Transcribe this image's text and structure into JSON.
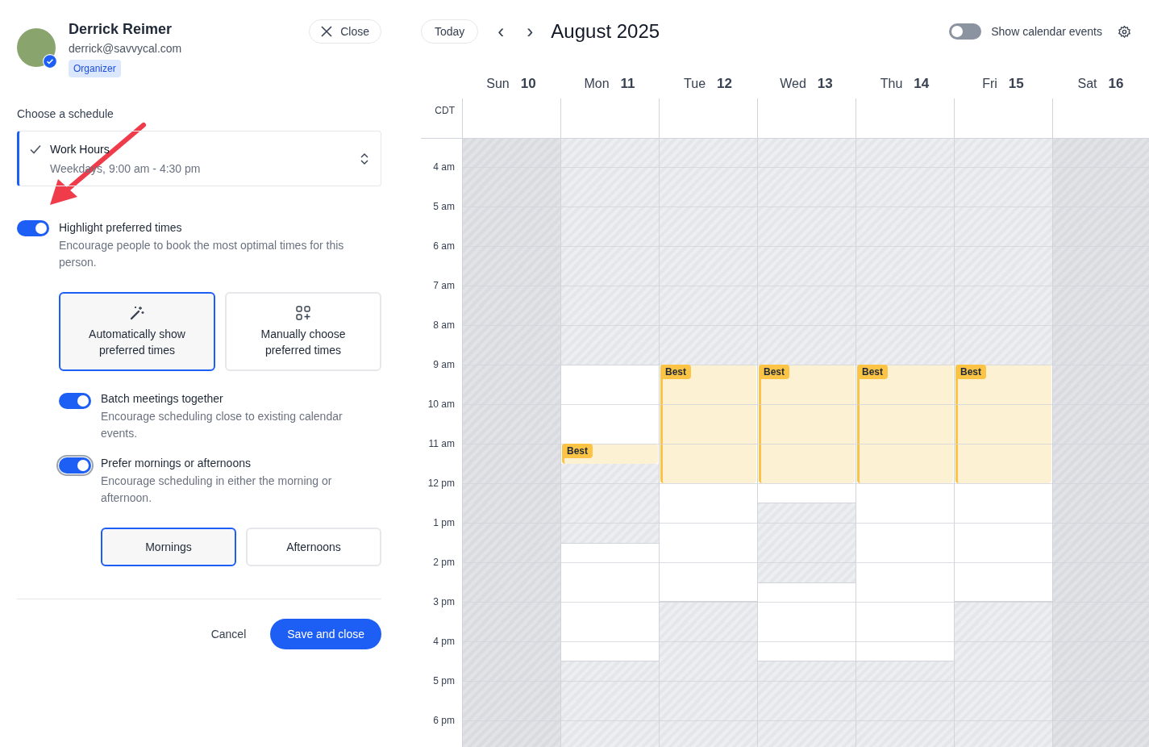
{
  "person": {
    "name": "Derrick Reimer",
    "email": "derrick@savvycal.com",
    "role": "Organizer",
    "verified": true
  },
  "close_button": {
    "label": "Close"
  },
  "schedule": {
    "label": "Choose a schedule",
    "name": "Work Hours",
    "detail": "Weekdays, 9:00 am - 4:30 pm",
    "checked": true
  },
  "highlight": {
    "label": "Highlight preferred times",
    "description": "Encourage people to book the most optimal times for this person.",
    "on": true
  },
  "modes": [
    {
      "label": "Automatically show preferred times",
      "kind": "auto",
      "selected": true
    },
    {
      "label": "Manually choose preferred times",
      "kind": "manual",
      "selected": false
    }
  ],
  "options": [
    {
      "label": "Batch meetings together",
      "description": "Encourage scheduling close to existing calendar events.",
      "on": true,
      "focused": false
    },
    {
      "label": "Prefer mornings or afternoons",
      "description": "Encourage scheduling in either the morning or afternoon.",
      "on": true,
      "focused": true
    }
  ],
  "day_parts": [
    {
      "label": "Mornings",
      "selected": true
    },
    {
      "label": "Afternoons",
      "selected": false
    }
  ],
  "footer": {
    "cancel": "Cancel",
    "save": "Save and close"
  },
  "toolbar": {
    "today": "Today",
    "prev": "‹",
    "next": "›",
    "title": "August 2025",
    "toggle_label": "Show calendar events",
    "toggle_on": false
  },
  "timezone": "CDT",
  "hours": [
    "4 am",
    "5 am",
    "6 am",
    "7 am",
    "8 am",
    "9 am",
    "10 am",
    "11 am",
    "12 pm",
    "1 pm",
    "2 pm",
    "3 pm",
    "4 pm",
    "5 pm",
    "6 pm"
  ],
  "days": [
    {
      "name": "Sun",
      "date": "10",
      "slots": [
        {
          "kind": "off"
        },
        {
          "kind": "off"
        },
        {
          "kind": "off"
        },
        {
          "kind": "off"
        },
        {
          "kind": "off"
        },
        {
          "kind": "off"
        },
        {
          "kind": "off"
        },
        {
          "kind": "off"
        },
        {
          "kind": "off"
        },
        {
          "kind": "off"
        },
        {
          "kind": "off"
        },
        {
          "kind": "off"
        },
        {
          "kind": "off"
        },
        {
          "kind": "off"
        },
        {
          "kind": "off"
        },
        {
          "kind": "off"
        },
        {
          "kind": "off"
        },
        {
          "kind": "off"
        },
        {
          "kind": "off"
        },
        {
          "kind": "off"
        },
        {
          "kind": "off"
        },
        {
          "kind": "off"
        },
        {
          "kind": "off"
        },
        {
          "kind": "off"
        },
        {
          "kind": "off"
        },
        {
          "kind": "off"
        },
        {
          "kind": "off"
        },
        {
          "kind": "off"
        },
        {
          "kind": "off"
        },
        {
          "kind": "off"
        },
        {
          "kind": "off"
        },
        {
          "kind": "off"
        }
      ]
    },
    {
      "name": "Mon",
      "date": "11",
      "best_label": "Best",
      "slots": [
        {
          "kind": "unavailable"
        },
        {
          "kind": "unavailable"
        },
        {
          "kind": "unavailable"
        },
        {
          "kind": "unavailable"
        },
        {
          "kind": "unavailable"
        },
        {
          "kind": "unavailable"
        },
        {
          "kind": "unavailable"
        },
        {
          "kind": "unavailable"
        },
        {
          "kind": "unavailable"
        },
        {
          "kind": "unavailable"
        },
        {
          "kind": "unavailable"
        },
        {
          "kind": "unavailable"
        },
        {
          "kind": "available"
        },
        {
          "kind": "available"
        },
        {
          "kind": "available"
        },
        {
          "kind": "available"
        },
        {
          "kind": "best"
        },
        {
          "kind": "unavailable"
        },
        {
          "kind": "unavailable"
        },
        {
          "kind": "unavailable"
        },
        {
          "kind": "unavailable"
        },
        {
          "kind": "available"
        },
        {
          "kind": "available"
        },
        {
          "kind": "available"
        },
        {
          "kind": "available"
        },
        {
          "kind": "available"
        },
        {
          "kind": "available"
        },
        {
          "kind": "unavailable"
        },
        {
          "kind": "unavailable"
        },
        {
          "kind": "unavailable"
        },
        {
          "kind": "unavailable"
        },
        {
          "kind": "unavailable"
        }
      ]
    },
    {
      "name": "Tue",
      "date": "12",
      "best_label": "Best",
      "slots": [
        {
          "kind": "unavailable"
        },
        {
          "kind": "unavailable"
        },
        {
          "kind": "unavailable"
        },
        {
          "kind": "unavailable"
        },
        {
          "kind": "unavailable"
        },
        {
          "kind": "unavailable"
        },
        {
          "kind": "unavailable"
        },
        {
          "kind": "unavailable"
        },
        {
          "kind": "unavailable"
        },
        {
          "kind": "unavailable"
        },
        {
          "kind": "unavailable"
        },
        {
          "kind": "unavailable"
        },
        {
          "kind": "best"
        },
        {
          "kind": "best"
        },
        {
          "kind": "best"
        },
        {
          "kind": "best"
        },
        {
          "kind": "best"
        },
        {
          "kind": "best"
        },
        {
          "kind": "available"
        },
        {
          "kind": "available"
        },
        {
          "kind": "available"
        },
        {
          "kind": "available"
        },
        {
          "kind": "available"
        },
        {
          "kind": "available"
        },
        {
          "kind": "unavailable"
        },
        {
          "kind": "unavailable"
        },
        {
          "kind": "unavailable"
        },
        {
          "kind": "unavailable"
        },
        {
          "kind": "unavailable"
        },
        {
          "kind": "unavailable"
        },
        {
          "kind": "unavailable"
        },
        {
          "kind": "unavailable"
        }
      ]
    },
    {
      "name": "Wed",
      "date": "13",
      "best_label": "Best",
      "slots": [
        {
          "kind": "unavailable"
        },
        {
          "kind": "unavailable"
        },
        {
          "kind": "unavailable"
        },
        {
          "kind": "unavailable"
        },
        {
          "kind": "unavailable"
        },
        {
          "kind": "unavailable"
        },
        {
          "kind": "unavailable"
        },
        {
          "kind": "unavailable"
        },
        {
          "kind": "unavailable"
        },
        {
          "kind": "unavailable"
        },
        {
          "kind": "unavailable"
        },
        {
          "kind": "unavailable"
        },
        {
          "kind": "best"
        },
        {
          "kind": "best"
        },
        {
          "kind": "best"
        },
        {
          "kind": "best"
        },
        {
          "kind": "best"
        },
        {
          "kind": "best"
        },
        {
          "kind": "available"
        },
        {
          "kind": "unavailable"
        },
        {
          "kind": "unavailable"
        },
        {
          "kind": "unavailable"
        },
        {
          "kind": "unavailable"
        },
        {
          "kind": "available"
        },
        {
          "kind": "available"
        },
        {
          "kind": "available"
        },
        {
          "kind": "available"
        },
        {
          "kind": "unavailable"
        },
        {
          "kind": "unavailable"
        },
        {
          "kind": "unavailable"
        },
        {
          "kind": "unavailable"
        },
        {
          "kind": "unavailable"
        }
      ]
    },
    {
      "name": "Thu",
      "date": "14",
      "best_label": "Best",
      "slots": [
        {
          "kind": "unavailable"
        },
        {
          "kind": "unavailable"
        },
        {
          "kind": "unavailable"
        },
        {
          "kind": "unavailable"
        },
        {
          "kind": "unavailable"
        },
        {
          "kind": "unavailable"
        },
        {
          "kind": "unavailable"
        },
        {
          "kind": "unavailable"
        },
        {
          "kind": "unavailable"
        },
        {
          "kind": "unavailable"
        },
        {
          "kind": "unavailable"
        },
        {
          "kind": "unavailable"
        },
        {
          "kind": "best"
        },
        {
          "kind": "best"
        },
        {
          "kind": "best"
        },
        {
          "kind": "best"
        },
        {
          "kind": "best"
        },
        {
          "kind": "best"
        },
        {
          "kind": "available"
        },
        {
          "kind": "available"
        },
        {
          "kind": "available"
        },
        {
          "kind": "available"
        },
        {
          "kind": "available"
        },
        {
          "kind": "available"
        },
        {
          "kind": "available"
        },
        {
          "kind": "available"
        },
        {
          "kind": "available"
        },
        {
          "kind": "unavailable"
        },
        {
          "kind": "unavailable"
        },
        {
          "kind": "unavailable"
        },
        {
          "kind": "unavailable"
        },
        {
          "kind": "unavailable"
        }
      ]
    },
    {
      "name": "Fri",
      "date": "15",
      "best_label": "Best",
      "slots": [
        {
          "kind": "unavailable"
        },
        {
          "kind": "unavailable"
        },
        {
          "kind": "unavailable"
        },
        {
          "kind": "unavailable"
        },
        {
          "kind": "unavailable"
        },
        {
          "kind": "unavailable"
        },
        {
          "kind": "unavailable"
        },
        {
          "kind": "unavailable"
        },
        {
          "kind": "unavailable"
        },
        {
          "kind": "unavailable"
        },
        {
          "kind": "unavailable"
        },
        {
          "kind": "unavailable"
        },
        {
          "kind": "best"
        },
        {
          "kind": "best"
        },
        {
          "kind": "best"
        },
        {
          "kind": "best"
        },
        {
          "kind": "best"
        },
        {
          "kind": "best"
        },
        {
          "kind": "available"
        },
        {
          "kind": "available"
        },
        {
          "kind": "available"
        },
        {
          "kind": "available"
        },
        {
          "kind": "available"
        },
        {
          "kind": "available"
        },
        {
          "kind": "unavailable"
        },
        {
          "kind": "unavailable"
        },
        {
          "kind": "unavailable"
        },
        {
          "kind": "unavailable"
        },
        {
          "kind": "unavailable"
        },
        {
          "kind": "unavailable"
        },
        {
          "kind": "unavailable"
        },
        {
          "kind": "unavailable"
        }
      ]
    },
    {
      "name": "Sat",
      "date": "16",
      "slots": [
        {
          "kind": "off"
        },
        {
          "kind": "off"
        },
        {
          "kind": "off"
        },
        {
          "kind": "off"
        },
        {
          "kind": "off"
        },
        {
          "kind": "off"
        },
        {
          "kind": "off"
        },
        {
          "kind": "off"
        },
        {
          "kind": "off"
        },
        {
          "kind": "off"
        },
        {
          "kind": "off"
        },
        {
          "kind": "off"
        },
        {
          "kind": "off"
        },
        {
          "kind": "off"
        },
        {
          "kind": "off"
        },
        {
          "kind": "off"
        },
        {
          "kind": "off"
        },
        {
          "kind": "off"
        },
        {
          "kind": "off"
        },
        {
          "kind": "off"
        },
        {
          "kind": "off"
        },
        {
          "kind": "off"
        },
        {
          "kind": "off"
        },
        {
          "kind": "off"
        },
        {
          "kind": "off"
        },
        {
          "kind": "off"
        },
        {
          "kind": "off"
        },
        {
          "kind": "off"
        },
        {
          "kind": "off"
        },
        {
          "kind": "off"
        },
        {
          "kind": "off"
        },
        {
          "kind": "off"
        }
      ]
    }
  ],
  "annotation": {
    "kind": "arrow"
  }
}
